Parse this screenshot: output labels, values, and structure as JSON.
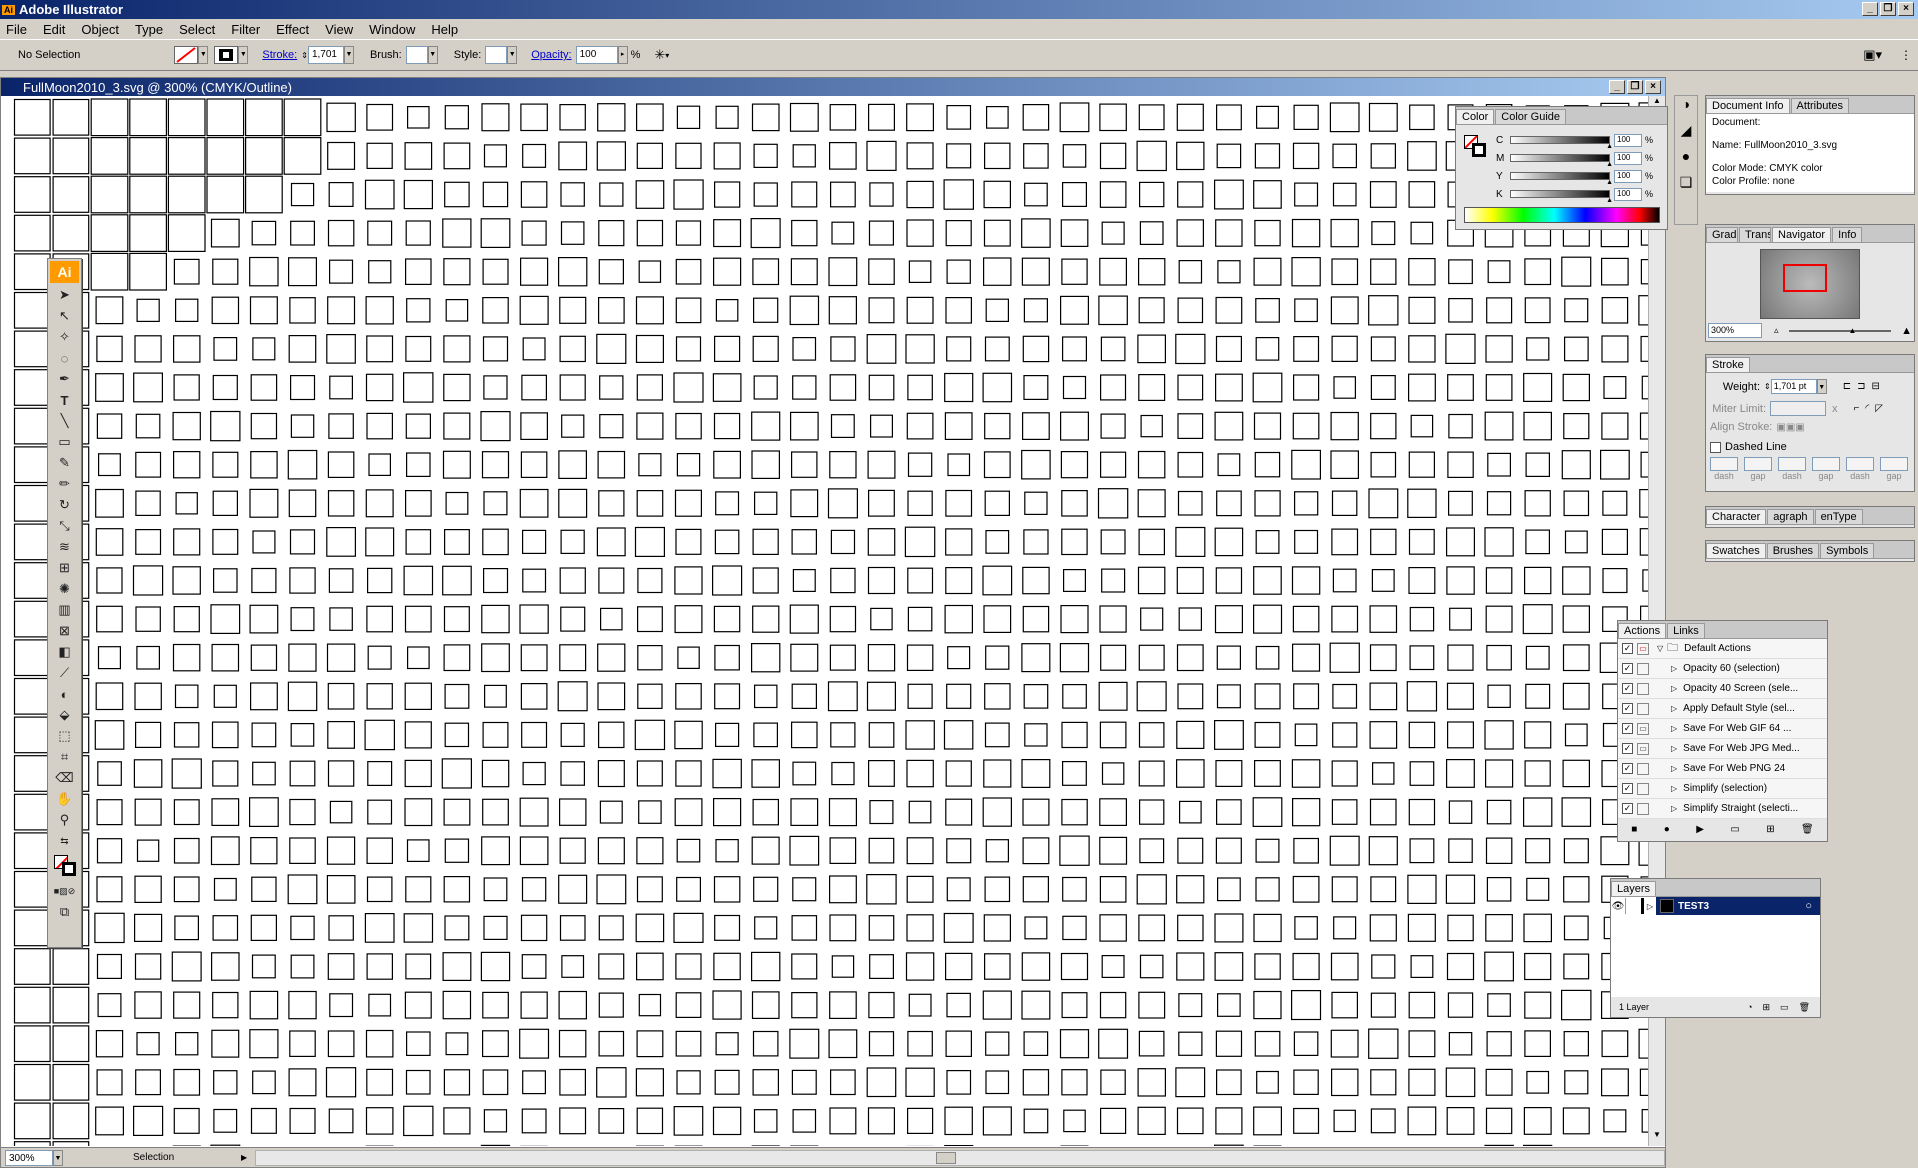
{
  "app_title": "Adobe Illustrator",
  "menu": [
    "File",
    "Edit",
    "Object",
    "Type",
    "Select",
    "Filter",
    "Effect",
    "View",
    "Window",
    "Help"
  ],
  "control": {
    "selection": "No Selection",
    "stroke_label": "Stroke:",
    "stroke_value": "1,701",
    "brush_label": "Brush:",
    "style_label": "Style:",
    "opacity_label": "Opacity:",
    "opacity_value": "100",
    "opacity_unit": "%"
  },
  "document": {
    "title": "FullMoon2010_3.svg @ 300% (CMYK/Outline)",
    "zoom": "300%",
    "status": "Selection"
  },
  "color_panel": {
    "tabs": [
      "Color",
      "Color Guide"
    ],
    "channels": [
      {
        "name": "C",
        "value": "100"
      },
      {
        "name": "M",
        "value": "100"
      },
      {
        "name": "Y",
        "value": "100"
      },
      {
        "name": "K",
        "value": "100"
      }
    ],
    "unit": "%"
  },
  "docinfo_panel": {
    "tabs": [
      "Document Info",
      "Attributes"
    ],
    "lines": [
      "Document:",
      "Name: FullMoon2010_3.svg",
      "Color Mode: CMYK color",
      "Color Profile: none"
    ]
  },
  "navigator_panel": {
    "tabs": [
      "Gradie",
      "Trans",
      "Navigator",
      "Info"
    ],
    "zoom": "300%"
  },
  "stroke_panel": {
    "tab": "Stroke",
    "weight_label": "Weight:",
    "weight_value": "1,701 pt",
    "miter_label": "Miter Limit:",
    "miter_unit": "x",
    "align_label": "Align Stroke:",
    "dashed_label": "Dashed Line",
    "dash_labels": [
      "dash",
      "gap",
      "dash",
      "gap",
      "dash",
      "gap"
    ]
  },
  "character_panel": {
    "tabs": [
      "Character",
      "agraph",
      "enType"
    ]
  },
  "swatches_panel": {
    "tabs": [
      "Swatches",
      "Brushes",
      "Symbols"
    ]
  },
  "actions_panel": {
    "tabs": [
      "Actions",
      "Links"
    ],
    "items": [
      "Default Actions",
      "Opacity 60 (selection)",
      "Opacity 40 Screen (sele...",
      "Apply Default Style (sel...",
      "Save For Web GIF 64 ...",
      "Save For Web JPG Med...",
      "Save For Web PNG 24",
      "Simplify (selection)",
      "Simplify Straight (selecti..."
    ]
  },
  "layers_panel": {
    "tab": "Layers",
    "layer": "TEST3",
    "count": "1 Layer"
  },
  "toolbox": {
    "logo": "Ai"
  }
}
